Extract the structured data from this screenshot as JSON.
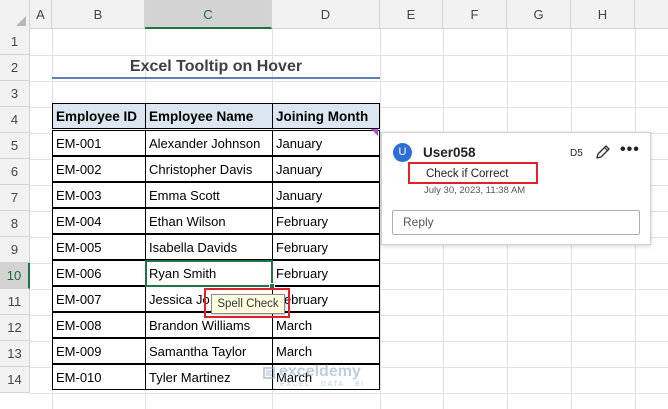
{
  "columns": [
    "A",
    "B",
    "C",
    "D",
    "E",
    "F",
    "G",
    "H"
  ],
  "rows": [
    "1",
    "2",
    "3",
    "4",
    "5",
    "6",
    "7",
    "8",
    "9",
    "10",
    "11",
    "12",
    "13",
    "14"
  ],
  "title": "Excel Tooltip on Hover",
  "table": {
    "headers": [
      "Employee ID",
      "Employee Name",
      "Joining Month"
    ],
    "rows": [
      [
        "EM-001",
        "Alexander Johnson",
        "January"
      ],
      [
        "EM-002",
        "Christopher Davis",
        "January"
      ],
      [
        "EM-003",
        "Emma Scott",
        "January"
      ],
      [
        "EM-004",
        "Ethan Wilson",
        "February"
      ],
      [
        "EM-005",
        "Isabella Davids",
        "February"
      ],
      [
        "EM-006",
        "Ryan Smith",
        "February"
      ],
      [
        "EM-007",
        "Jessica Jo",
        "February"
      ],
      [
        "EM-008",
        "Brandon Williams",
        "March"
      ],
      [
        "EM-009",
        "Samantha Taylor",
        "March"
      ],
      [
        "EM-010",
        "Tyler Martinez",
        "March"
      ]
    ]
  },
  "comment": {
    "avatar": "U",
    "user": "User058",
    "cell": "D5",
    "text": "Check if Correct",
    "timestamp": "July 30, 2023, 11:38 AM",
    "reply_placeholder": "Reply"
  },
  "tooltip": {
    "text": "Spell Check"
  },
  "watermark": {
    "name": "exceldemy",
    "tagline": "EXCEL · DATA · BI"
  },
  "colors": {
    "accent": "#217346",
    "comment_flag": "#b04fc6",
    "highlight_box": "#e0202a",
    "avatar": "#2f6fd3"
  }
}
